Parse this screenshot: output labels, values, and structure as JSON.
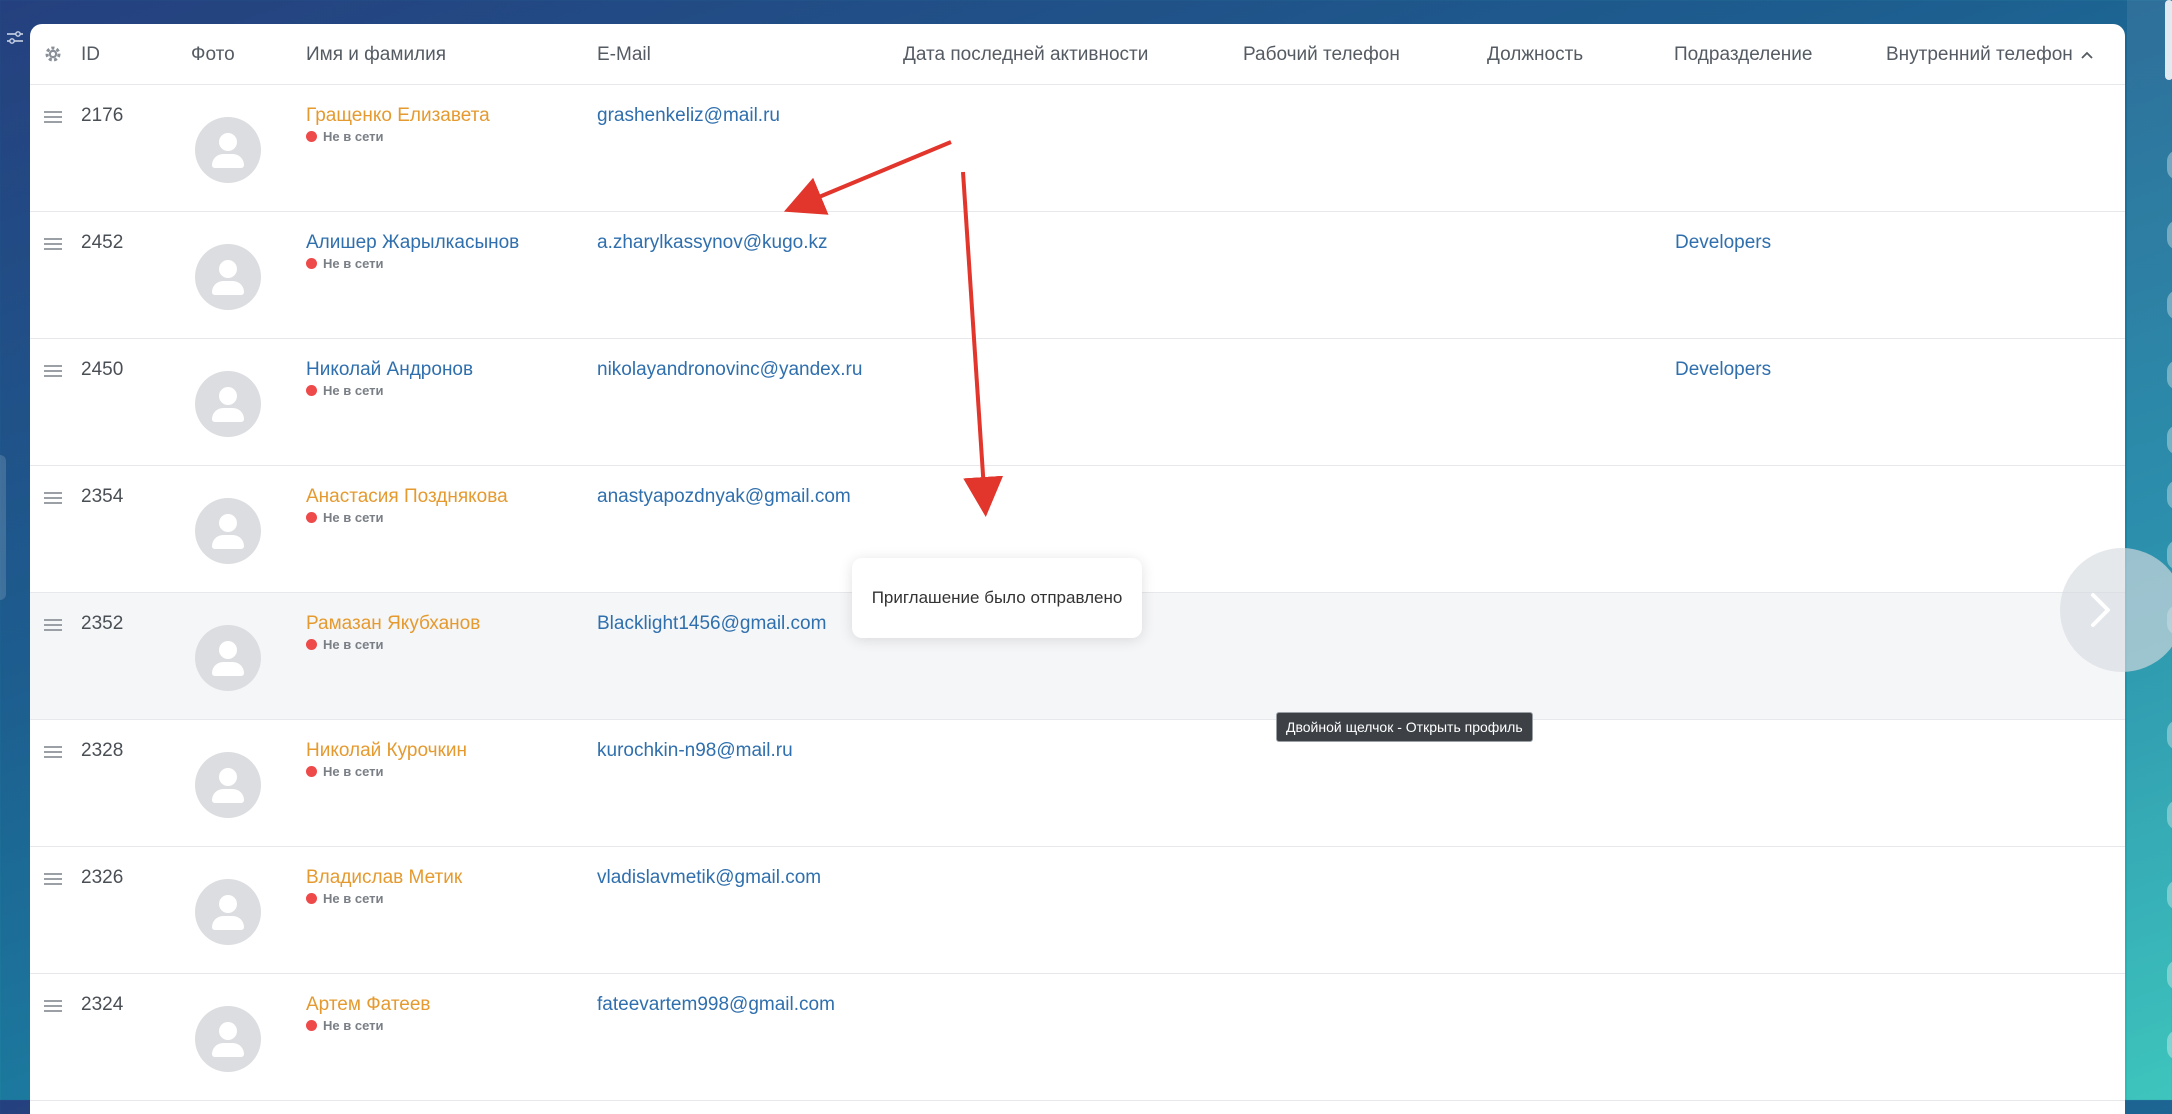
{
  "colors": {
    "accent_link": "#2f6fad",
    "name_orange": "#e59a2f",
    "offline_dot": "#ee4a4a",
    "annotation_arrow": "#e2352c"
  },
  "icons": {
    "settings": "gear-icon",
    "row_handle": "drag-handle-icon",
    "avatar": "user-placeholder-icon",
    "sort": "chevron-up-icon",
    "next": "chevron-right-icon",
    "filter": "sliders-icon"
  },
  "table": {
    "columns": {
      "id": "ID",
      "photo": "Фото",
      "name": "Имя и фамилия",
      "email": "E-Mail",
      "last_activity": "Дата последней активности",
      "work_phone": "Рабочий телефон",
      "position": "Должность",
      "department": "Подразделение",
      "internal_phone": "Внутренний телефон"
    },
    "sorted_by": "internal_phone",
    "rows": [
      {
        "id": "2176",
        "name": "Гращенко Елизавета",
        "name_color": "orange",
        "status": "Не в сети",
        "email": "grashenkeliz@mail.ru",
        "department": ""
      },
      {
        "id": "2452",
        "name": "Алишер Жарылкасынов",
        "name_color": "blue",
        "status": "Не в сети",
        "email": "a.zharylkassynov@kugo.kz",
        "department": "Developers"
      },
      {
        "id": "2450",
        "name": "Николай Андронов",
        "name_color": "blue",
        "status": "Не в сети",
        "email": "nikolayandronovinc@yandex.ru",
        "department": "Developers"
      },
      {
        "id": "2354",
        "name": "Анастасия Позднякова",
        "name_color": "orange",
        "status": "Не в сети",
        "email": "anastyapozdnyak@gmail.com",
        "department": ""
      },
      {
        "id": "2352",
        "name": "Рамазан Якубханов",
        "name_color": "orange",
        "status": "Не в сети",
        "email": "Blacklight1456@gmail.com",
        "department": ""
      },
      {
        "id": "2328",
        "name": "Николай Курочкин",
        "name_color": "orange",
        "status": "Не в сети",
        "email": "kurochkin-n98@mail.ru",
        "department": ""
      },
      {
        "id": "2326",
        "name": "Владислав Метик",
        "name_color": "orange",
        "status": "Не в сети",
        "email": "vladislavmetik@gmail.com",
        "department": ""
      },
      {
        "id": "2324",
        "name": "Артем Фатеев",
        "name_color": "orange",
        "status": "Не в сети",
        "email": "fateevartem998@gmail.com",
        "department": ""
      }
    ]
  },
  "toast": {
    "message": "Приглашение было отправлено"
  },
  "tooltip": {
    "text": "Двойной щелчок - Открыть профиль"
  }
}
